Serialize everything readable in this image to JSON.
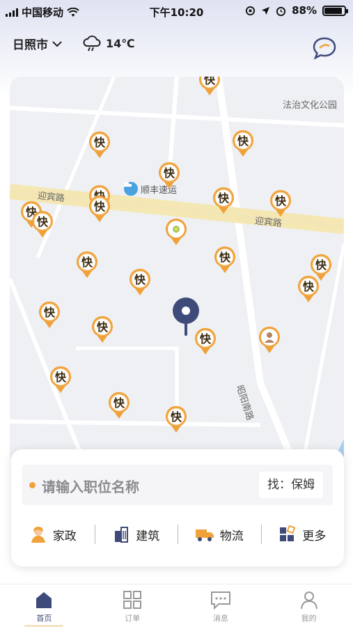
{
  "status_bar": {
    "carrier": "中国移动",
    "time": "下午10:20",
    "battery": "88%",
    "battery_level": 0.88
  },
  "header": {
    "city": "日照市",
    "temperature": "14℃",
    "weather_icon": "cloud-rain-icon",
    "chat_icon": "chat-bubble-icon"
  },
  "map": {
    "road_labels": [
      "迎宾路",
      "迎宾路",
      "昭阳南路"
    ],
    "place_labels": [
      "法治文化公园"
    ],
    "poi": {
      "name": "顺丰速运",
      "icon": "delivery-truck-icon"
    },
    "pin_glyph": "快",
    "colors": {
      "pin": "#f0a23a",
      "center_marker": "#3e4a7a",
      "road": "#f5e7b3"
    }
  },
  "search": {
    "placeholder": "请输入职位名称",
    "suggestion": "找：保姆"
  },
  "categories": [
    {
      "label": "家政",
      "icon": "housekeeper-icon"
    },
    {
      "label": "建筑",
      "icon": "building-icon"
    },
    {
      "label": "物流",
      "icon": "truck-icon"
    },
    {
      "label": "更多",
      "icon": "more-grid-icon"
    }
  ],
  "bottom_nav": [
    {
      "label": "首页",
      "icon": "home-icon",
      "active": true
    },
    {
      "label": "订单",
      "icon": "grid-icon",
      "active": false
    },
    {
      "label": "消息",
      "icon": "message-icon",
      "active": false
    },
    {
      "label": "我的",
      "icon": "user-icon",
      "active": false
    }
  ]
}
